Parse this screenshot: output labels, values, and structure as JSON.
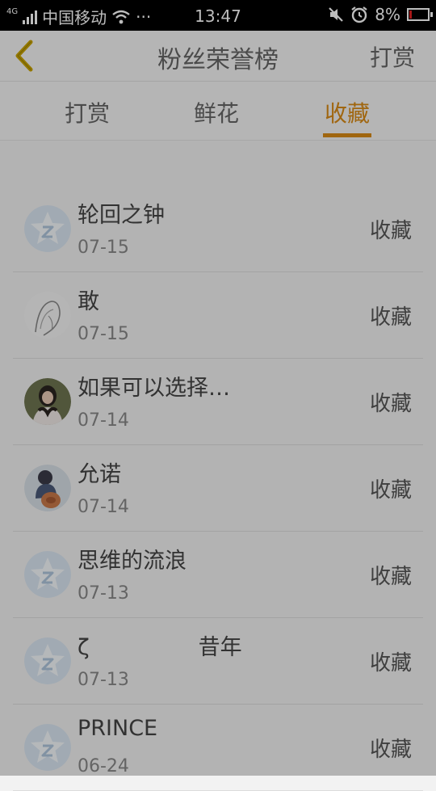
{
  "status_bar": {
    "network_type": "4G",
    "carrier": "中国移动",
    "more": "···",
    "time": "13:47",
    "battery": "8%"
  },
  "header": {
    "title": "粉丝荣誉榜",
    "right_action": "打赏"
  },
  "tabs": [
    {
      "label": "打赏",
      "active": false
    },
    {
      "label": "鲜花",
      "active": false
    },
    {
      "label": "收藏",
      "active": true
    }
  ],
  "fans": [
    {
      "name": "轮回之钟",
      "date": "07-15",
      "action": "收藏",
      "avatar": "default-star-icon"
    },
    {
      "name": "敢",
      "date": "07-15",
      "action": "收藏",
      "avatar": "sketch-photo"
    },
    {
      "name": "如果可以选择…",
      "date": "07-14",
      "action": "收藏",
      "avatar": "girl-photo"
    },
    {
      "name": "允诺",
      "date": "07-14",
      "action": "收藏",
      "avatar": "girl-bag-photo"
    },
    {
      "name": "思维的流浪",
      "date": "07-13",
      "action": "收藏",
      "avatar": "default-star-icon"
    },
    {
      "name": "ζ　　　　　昔年",
      "date": "07-13",
      "action": "收藏",
      "avatar": "default-star-icon"
    },
    {
      "name": "PRINCE",
      "date": "06-24",
      "action": "收藏",
      "avatar": "default-star-icon"
    }
  ],
  "colors": {
    "accent": "#d88a16",
    "back_arrow": "#c8a200"
  }
}
